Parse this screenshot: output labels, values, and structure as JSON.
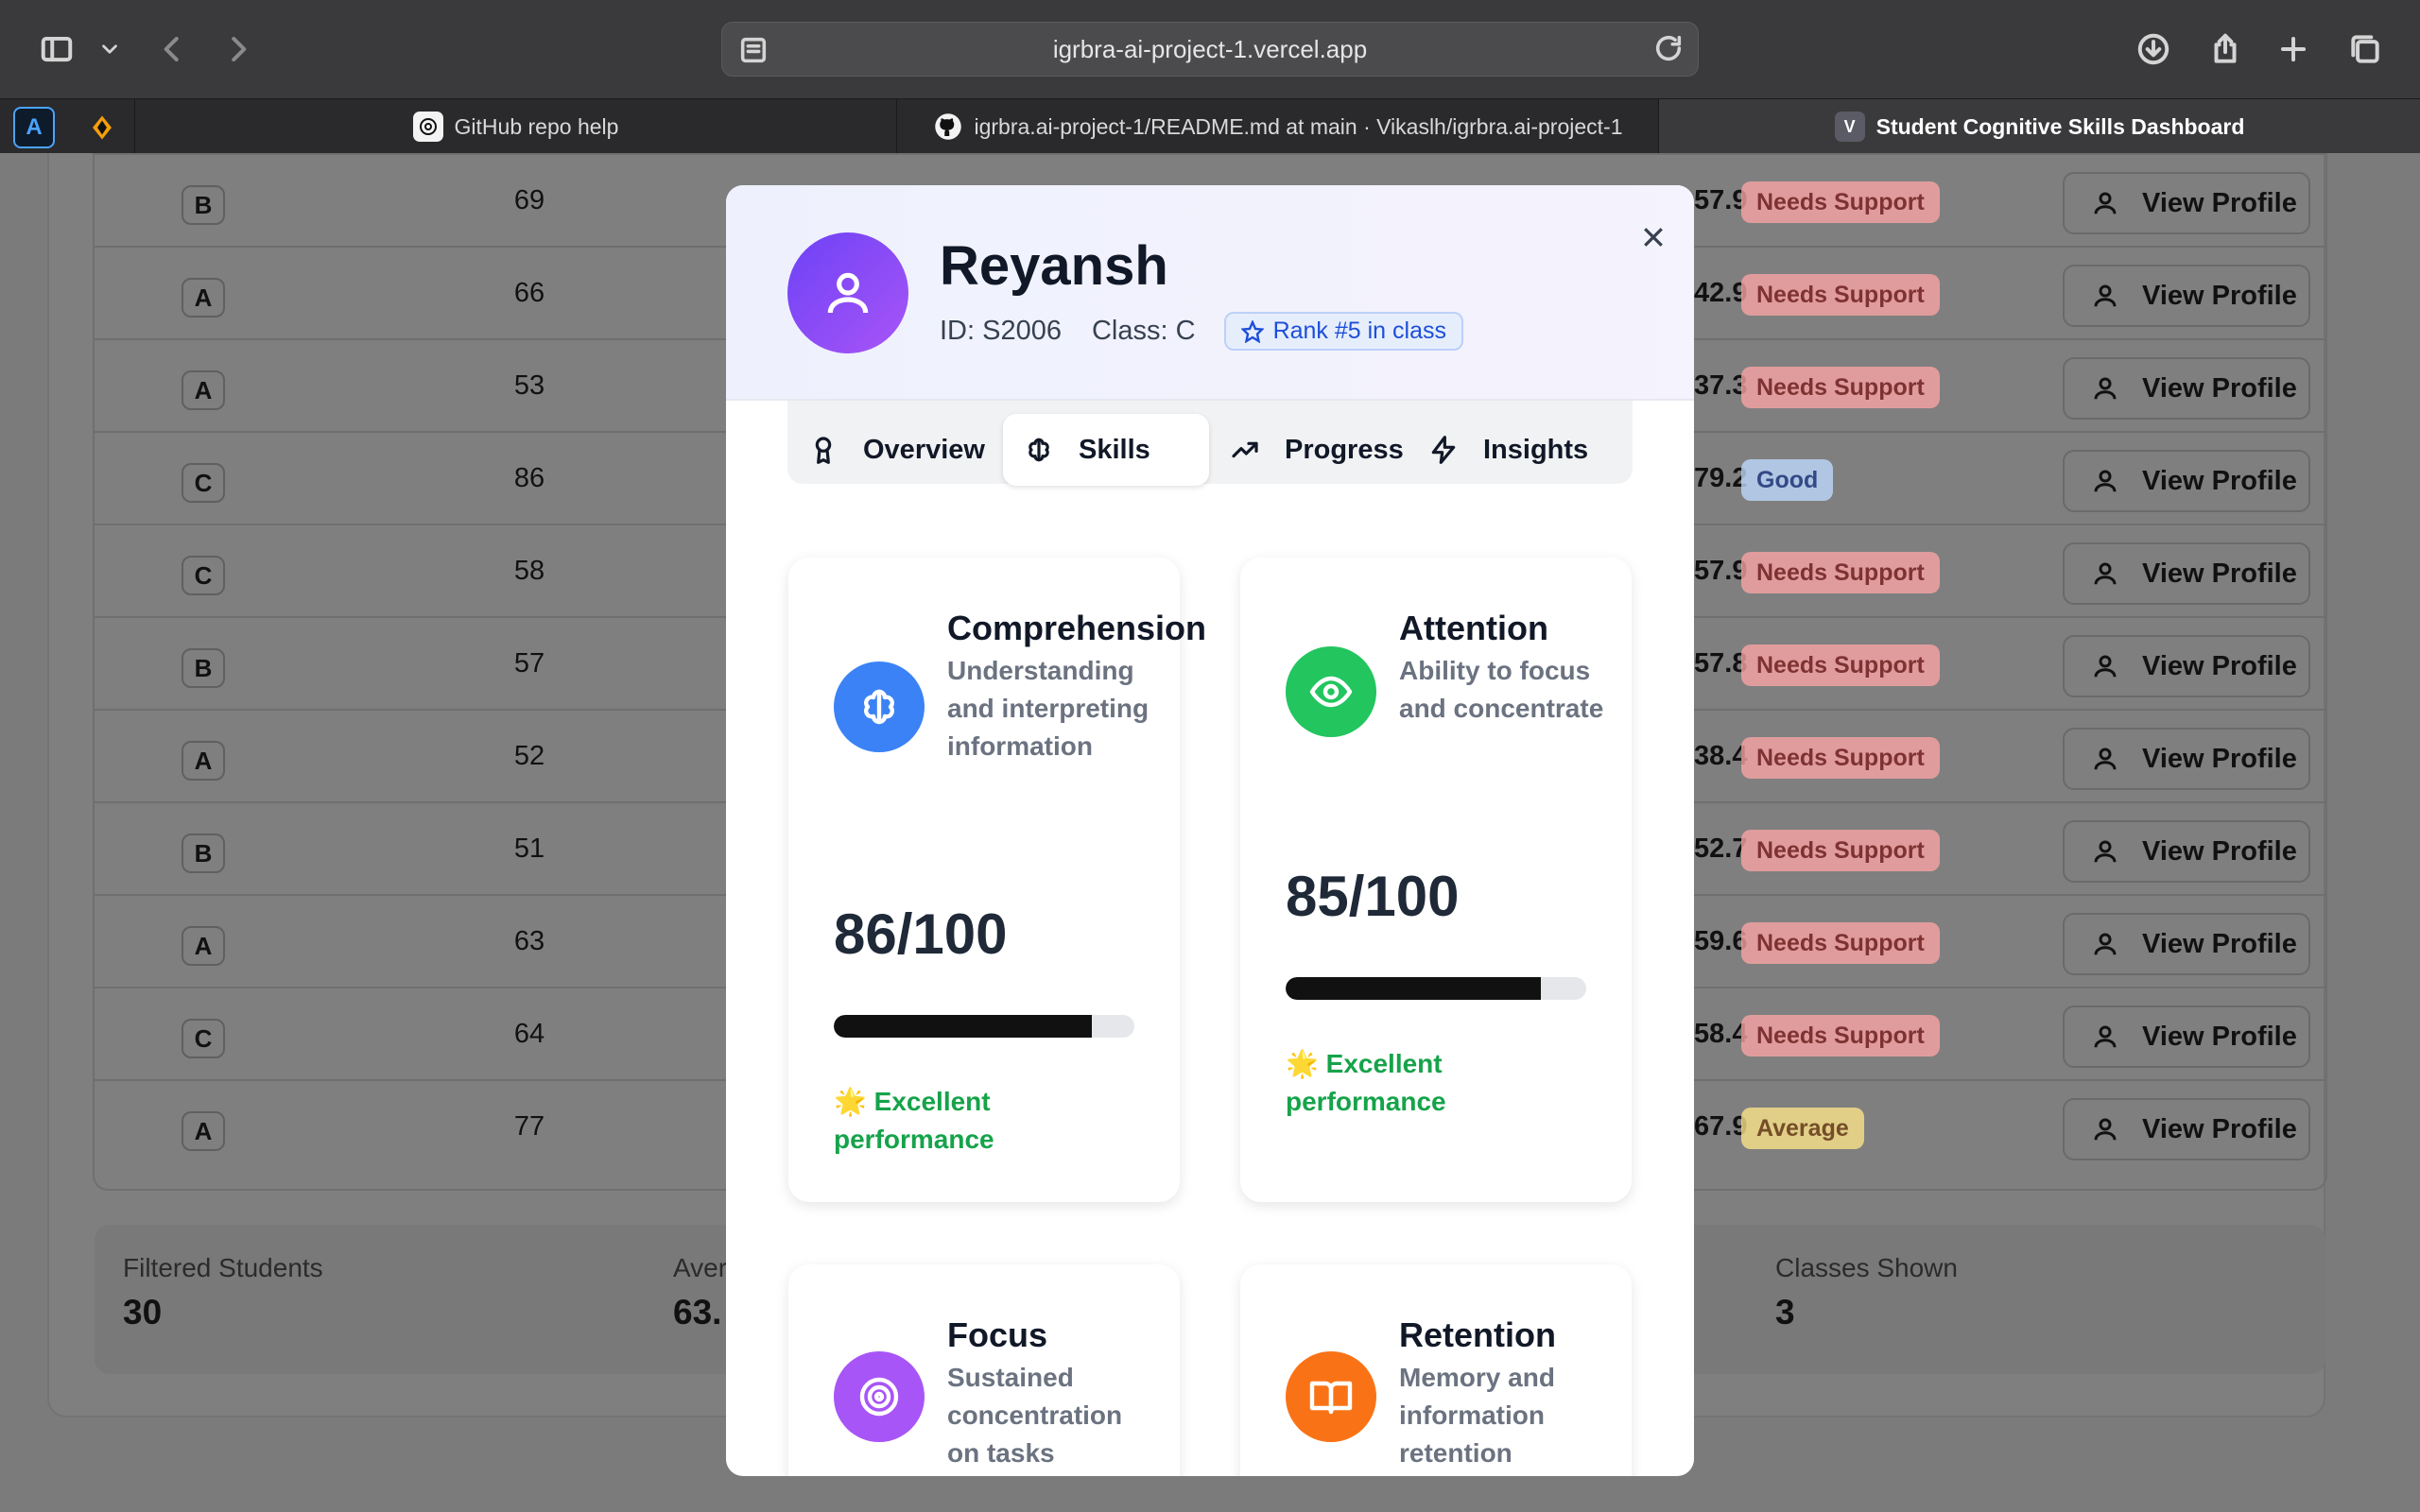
{
  "browser": {
    "url": "igrbra-ai-project-1.vercel.app",
    "tabs": [
      {
        "title": "GitHub repo help",
        "icon": "chatgpt-icon"
      },
      {
        "title": "igrbra.ai-project-1/README.md at main · Vikaslh/igrbra.ai-project-1",
        "icon": "github-icon"
      },
      {
        "title": "Student Cognitive Skills Dashboard",
        "icon": "vercel-v-icon",
        "favicon_letter": "V"
      }
    ],
    "pinned_tab_letter": "A"
  },
  "table": {
    "rows": [
      {
        "class": "B",
        "score": "69",
        "avg": "57.9",
        "status": "Needs Support"
      },
      {
        "class": "A",
        "score": "66",
        "avg": "42.9",
        "status": "Needs Support"
      },
      {
        "class": "A",
        "score": "53",
        "avg": "37.3",
        "status": "Needs Support"
      },
      {
        "class": "C",
        "score": "86",
        "avg": "79.2",
        "status": "Good"
      },
      {
        "class": "C",
        "score": "58",
        "avg": "57.9",
        "status": "Needs Support"
      },
      {
        "class": "B",
        "score": "57",
        "avg": "57.8",
        "status": "Needs Support"
      },
      {
        "class": "A",
        "score": "52",
        "avg": "38.4",
        "status": "Needs Support"
      },
      {
        "class": "B",
        "score": "51",
        "avg": "52.7",
        "status": "Needs Support"
      },
      {
        "class": "A",
        "score": "63",
        "avg": "59.6",
        "status": "Needs Support"
      },
      {
        "class": "C",
        "score": "64",
        "avg": "58.4",
        "status": "Needs Support"
      },
      {
        "class": "A",
        "score": "77",
        "avg": "67.9",
        "status": "Average"
      }
    ],
    "view_profile_label": "View Profile",
    "status_colors": {
      "Needs Support": "#fca5a5",
      "Good": "#bfdbfe",
      "Average": "#fde68a"
    }
  },
  "stats": {
    "filtered_students": {
      "label": "Filtered Students",
      "value": "30"
    },
    "average": {
      "label": "Aver",
      "value": "63."
    },
    "classes_shown": {
      "label": "Classes Shown",
      "value": "3"
    }
  },
  "student": {
    "name": "Reyansh",
    "id_label": "ID: S2006",
    "class_label": "Class: C",
    "rank_label": "Rank #5 in class"
  },
  "modal_tabs": [
    {
      "label": "Overview",
      "icon": "award-icon"
    },
    {
      "label": "Skills",
      "icon": "brain-icon",
      "active": true
    },
    {
      "label": "Progress",
      "icon": "trending-up-icon"
    },
    {
      "label": "Insights",
      "icon": "zap-icon"
    }
  ],
  "skills": [
    {
      "title": "Comprehension",
      "desc": "Understanding and interpreting information",
      "score": "86/100",
      "value": 86,
      "perf": "🌟 Excellent performance",
      "color": "#3b82f6",
      "icon": "brain-icon"
    },
    {
      "title": "Attention",
      "desc": "Ability to focus and concentrate",
      "score": "85/100",
      "value": 85,
      "perf": "🌟 Excellent performance",
      "color": "#22c55e",
      "icon": "eye-icon"
    },
    {
      "title": "Focus",
      "desc": "Sustained concentration on tasks",
      "color": "#a855f7",
      "icon": "target-icon"
    },
    {
      "title": "Retention",
      "desc": "Memory and information retention",
      "color": "#f97316",
      "icon": "book-open-icon"
    }
  ]
}
